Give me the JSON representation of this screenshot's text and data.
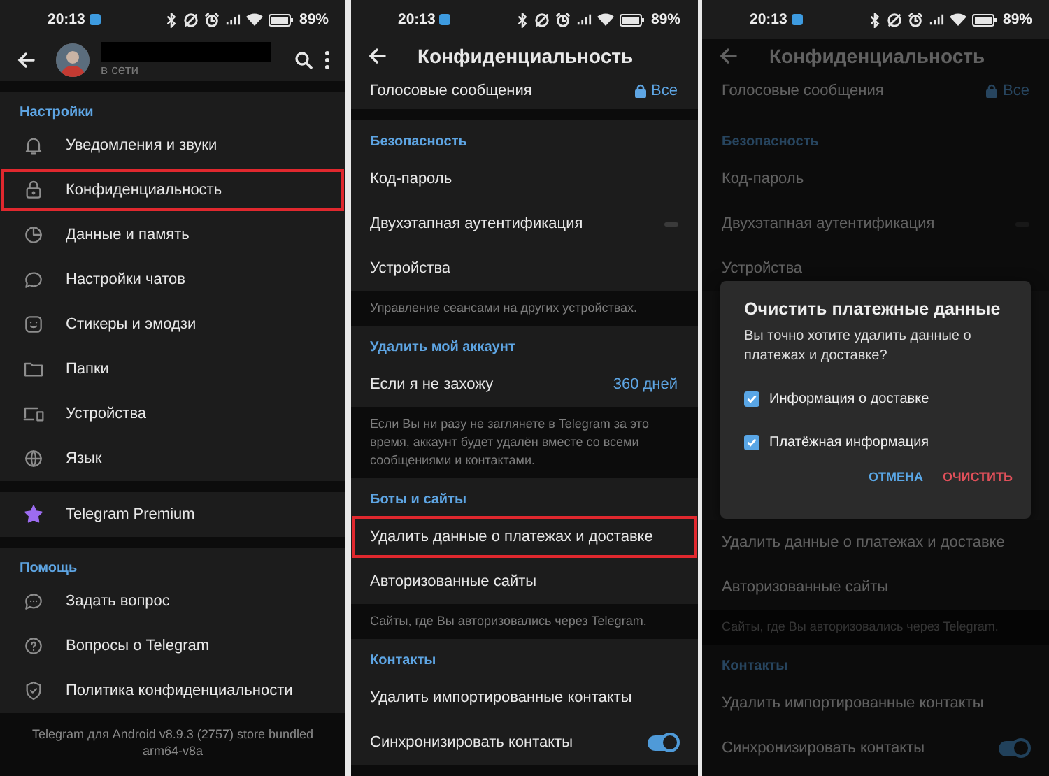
{
  "panels": [
    {
      "status_bar": {
        "time": "20:13",
        "battery": "89%"
      },
      "header": {
        "kind": "profile",
        "status": "в сети"
      },
      "items": [
        {
          "kind": "gap"
        },
        {
          "kind": "section",
          "title": "Настройки"
        },
        {
          "kind": "menu",
          "label": "Уведомления и звуки",
          "highlighted": false
        },
        {
          "kind": "menu",
          "label": "Конфиденциальность",
          "highlighted": true
        },
        {
          "kind": "menu",
          "label": "Данные и память",
          "highlighted": false
        },
        {
          "kind": "menu",
          "label": "Настройки чатов",
          "highlighted": false
        },
        {
          "kind": "menu",
          "label": "Стикеры и эмодзи",
          "highlighted": false
        },
        {
          "kind": "menu",
          "label": "Папки",
          "highlighted": false
        },
        {
          "kind": "menu",
          "label": "Устройства",
          "highlighted": false
        },
        {
          "kind": "menu",
          "label": "Язык",
          "highlighted": false
        },
        {
          "kind": "gap"
        },
        {
          "kind": "menu",
          "label": "Telegram Premium",
          "highlighted": false
        },
        {
          "kind": "gap"
        },
        {
          "kind": "section",
          "title": "Помощь"
        },
        {
          "kind": "menu",
          "label": "Задать вопрос",
          "highlighted": false
        },
        {
          "kind": "menu",
          "label": "Вопросы о Telegram",
          "highlighted": false
        },
        {
          "kind": "menu",
          "label": "Политика конфиденциальности",
          "highlighted": false
        },
        {
          "kind": "footer",
          "lines": [
            "Telegram для Android v8.9.3 (2757) store bundled",
            "arm64-v8a"
          ]
        }
      ]
    },
    {
      "status_bar": {
        "time": "20:13",
        "battery": "89%"
      },
      "header": {
        "kind": "title",
        "title": "Конфиденциальность"
      },
      "items": [
        {
          "kind": "lock-row",
          "label": "Голосовые сообщения",
          "value": "Все",
          "highlighted": false
        },
        {
          "kind": "gap"
        },
        {
          "kind": "section",
          "title": "Безопасность"
        },
        {
          "kind": "row",
          "label": "Код-пароль",
          "highlighted": false
        },
        {
          "kind": "dash-row",
          "label": "Двухэтапная аутентификация",
          "highlighted": false
        },
        {
          "kind": "row",
          "label": "Устройства",
          "highlighted": false
        },
        {
          "kind": "hint",
          "text": "Управление сеансами на других устройствах."
        },
        {
          "kind": "section",
          "title": "Удалить мой аккаунт"
        },
        {
          "kind": "row",
          "label": "Если я не захожу",
          "value": "360 дней",
          "highlighted": false
        },
        {
          "kind": "hint",
          "text": "Если Вы ни разу не заглянете в Telegram за это время, аккаунт будет удалён вместе со всеми сообщениями и контактами."
        },
        {
          "kind": "section",
          "title": "Боты и сайты"
        },
        {
          "kind": "row",
          "label": "Удалить данные о платежах и доставке",
          "highlighted": true
        },
        {
          "kind": "row",
          "label": "Авторизованные сайты",
          "highlighted": false
        },
        {
          "kind": "hint",
          "text": "Сайты, где Вы авторизовались через Telegram."
        },
        {
          "kind": "section",
          "title": "Контакты"
        },
        {
          "kind": "row",
          "label": "Удалить импортированные контакты",
          "highlighted": false
        },
        {
          "kind": "toggle-row",
          "label": "Синхронизировать контакты",
          "on": true,
          "highlighted": false
        }
      ]
    },
    {
      "status_bar": {
        "time": "20:13",
        "battery": "89%"
      },
      "header": {
        "kind": "title",
        "title": "Конфиденциальность"
      },
      "items": [
        {
          "kind": "lock-row",
          "label": "Голосовые сообщения",
          "value": "Все",
          "highlighted": false
        },
        {
          "kind": "gap"
        },
        {
          "kind": "section",
          "title": "Безопасность"
        },
        {
          "kind": "row",
          "label": "Код-пароль",
          "highlighted": false
        },
        {
          "kind": "dash-row",
          "label": "Двухэтапная аутентификация",
          "highlighted": false
        },
        {
          "kind": "row",
          "label": "Устройства",
          "highlighted": false
        },
        {
          "kind": "dialog",
          "title": "Очистить платежные данные",
          "text": "Вы точно хотите удалить данные о платежах и доставке?",
          "options": [
            {
              "label": "Информация о доставке",
              "checked": true
            },
            {
              "label": "Платёжная информация",
              "checked": true
            }
          ],
          "buttons": [
            {
              "label": "ОТМЕНА",
              "kind": "cancel"
            },
            {
              "label": "ОЧИСТИТЬ",
              "kind": "destructive"
            }
          ]
        },
        {
          "kind": "row",
          "label": "Удалить данные о платежах и доставке",
          "highlighted": false
        },
        {
          "kind": "row",
          "label": "Авторизованные сайты",
          "highlighted": false
        },
        {
          "kind": "hint",
          "text": "Сайты, где Вы авторизовались через Telegram."
        },
        {
          "kind": "section",
          "title": "Контакты"
        },
        {
          "kind": "row",
          "label": "Удалить импортированные контакты",
          "highlighted": false
        },
        {
          "kind": "toggle-row",
          "label": "Синхронизировать контакты",
          "on": true,
          "highlighted": false
        }
      ]
    }
  ]
}
